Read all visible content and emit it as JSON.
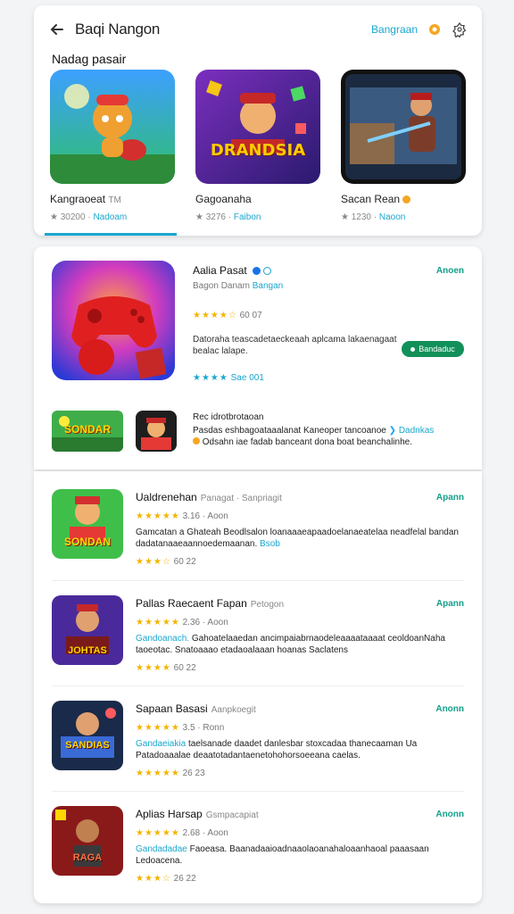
{
  "header": {
    "title": "Baqi Nangon",
    "link_label": "Bangraan",
    "icons": [
      "back-arrow-icon",
      "bell-icon",
      "settings-icon"
    ]
  },
  "featured": {
    "section_title": "Nadag pasair",
    "items": [
      {
        "name": "Kangraoeat",
        "badge": "TM",
        "rating": "★ 30200",
        "link": "Nadoam"
      },
      {
        "name": "Gagoanaha",
        "badge": "",
        "rating": "★ 3276",
        "link": "Faibon"
      },
      {
        "name": "Sacan Rean",
        "badge": "",
        "rating": "★ 1230",
        "link": "Naoon"
      }
    ],
    "thumb_text": "DRANDSIA"
  },
  "detail": {
    "title": "Aalia Pasat",
    "developer": "Bagon Danam",
    "developer_link": "Bangan",
    "rating_text": "60 07",
    "description": "Datoraha teascadetaeckeaah aplcama lakaenagaat bealac lalape.",
    "open_label": "Anoen",
    "install_label": "Bandaduc",
    "sub_text": "Sae 001",
    "recommend_title": "Rec idrotbrotaoan",
    "recommend_text": "Pasdas eshbagoataaalanat Kaneoper tancoanoe",
    "recommend_link": "Dadnkas",
    "recommend_text2": "Odsahn iae fadab banceant dona boat beanchalinhe.",
    "mini_text": "SONDAR"
  },
  "list": [
    {
      "title": "Ualdrenehan",
      "meta": "Panagat · Sanpriagit",
      "open_label": "Apann",
      "rating": "3.16 · Aoon",
      "desc_pre": "Gamcatan a Ghateah",
      "desc": "Beodlsalon loanaaaeapaadoelanaeatelaa neadfelal bandan dadatanaaeaannoedemaanan.",
      "desc_link": "Bsob",
      "foot": "60 22",
      "thumb_text": "SONDAN"
    },
    {
      "title": "Pallas Raecaent Fapan",
      "meta": "Petogon",
      "open_label": "Apann",
      "rating": "2.36 · Aoon",
      "desc_pre": "Gandoanach.",
      "desc": "Gahoatelaaedan ancimpaiabrnaodeleaaaataaaat ceoldoanNaha taoeotac. Snatoaaao etadaoalaaan hoanas Saclatens",
      "desc_link": "",
      "foot": "60 22",
      "thumb_text": "JOHTAS"
    },
    {
      "title": "Sapaan Basasi",
      "meta": "Aanpkoegit",
      "open_label": "Anonn",
      "rating": "3.5 · Ronn",
      "desc_pre": "Gandaeiakia",
      "desc": "taelsanade daadet danlesbar stoxcadaa thanecaaman Ua Patadoaaalae deaatotadantaenetohohorsoeeana caelas.",
      "desc_link": "",
      "foot": "26 23",
      "thumb_text": "SANDIAS"
    },
    {
      "title": "Aplias Harsap",
      "meta": "Gsmpacapiat",
      "open_label": "Anonn",
      "rating": "2.68 · Aoon",
      "desc_pre": "Gandadadae",
      "desc": "Faoeasa. Baanadaaioadnaaolaoanahaloaanhaoal paaasaan Ledoacena.",
      "desc_link": "",
      "foot": "26 22",
      "thumb_text": "RAGA"
    }
  ],
  "colors": {
    "accent": "#1aa7cf",
    "open_green": "#14a08a",
    "install_green": "#12905a",
    "star": "#f4b400"
  }
}
